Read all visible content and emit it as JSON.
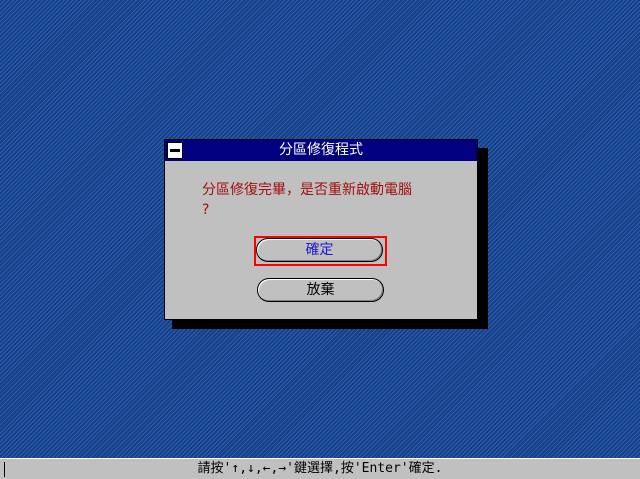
{
  "dialog": {
    "title": "分區修復程式",
    "message_line1": "分區修復完畢，是否重新啟動電腦",
    "message_line2": "?",
    "ok_label": "確定",
    "cancel_label": "放棄"
  },
  "statusbar": {
    "text": "請按'↑,↓,←,→'鍵選擇,按'Enter'確定."
  },
  "icons": {
    "system_menu": "system-menu-minus-icon"
  },
  "colors": {
    "desktop": "#1b4a94",
    "titlebar": "#000080",
    "message": "#a01010",
    "ok_text": "#1a1acc",
    "focus_border": "#ff0000"
  }
}
